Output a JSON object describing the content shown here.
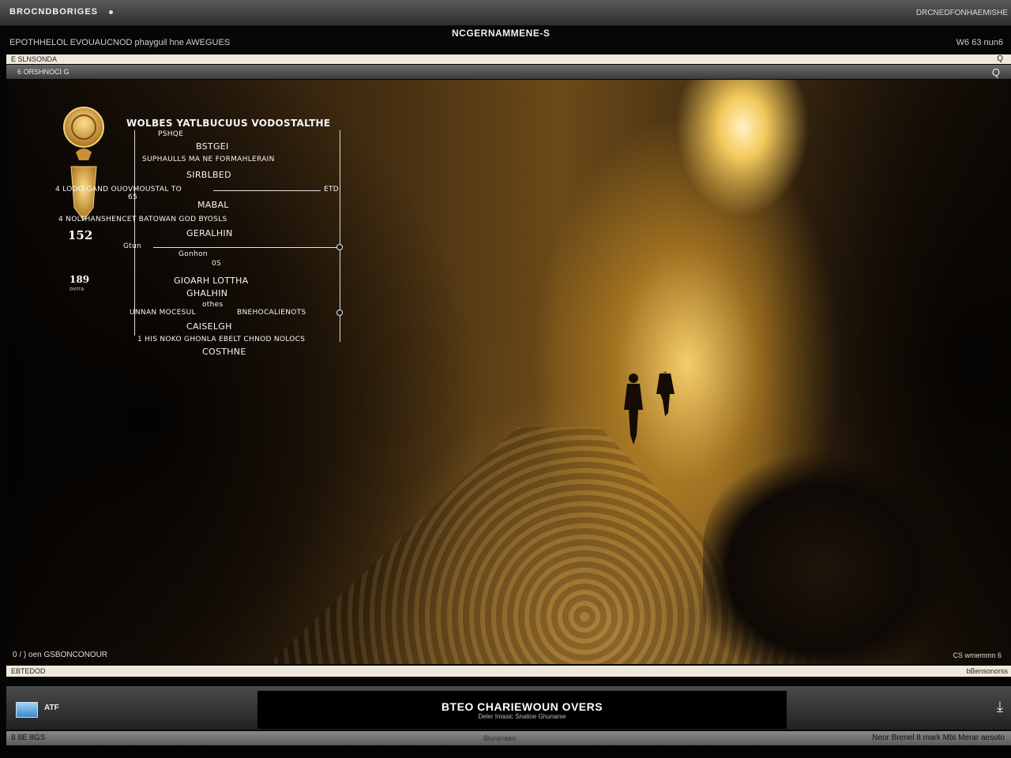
{
  "window": {
    "title": "BROCNDBORIGES",
    "right_status": "DRCNEDFONHAEMISHE"
  },
  "menubar": {
    "left_text": "EPOTHHELOL EVOUAUCNOD phayguil hne AWEGUES",
    "center_title": "NCGERNAMMENE-S",
    "right_text": "W6 63 nun6"
  },
  "address": {
    "left": "E SLNSONDA",
    "right": "Q"
  },
  "subbar": {
    "left": "6 ORSHNOCI G",
    "right": "Q"
  },
  "panel": {
    "stat_a": "152",
    "stat_b": "189",
    "stat_b_label": "ovrra",
    "heading": "WOLBES YATLBUCUUS VODOSTALTHE",
    "nodes": [
      {
        "text": "PSHQE"
      },
      {
        "text": "BSTGEI"
      },
      {
        "text": "SUPHAULLS MA NE FORMAHLERAIN"
      },
      {
        "text": "SIRBLBED"
      },
      {
        "text": "4 LODO GAND OUOVMOUSTAL TO"
      },
      {
        "text": "ETD"
      },
      {
        "text": "65"
      },
      {
        "text": "MABAL"
      },
      {
        "text": "4 NOLTHANSHENCET BATOWAN GOD BYOSLS"
      },
      {
        "text": "GERALHIN"
      },
      {
        "text": "Gtun"
      },
      {
        "text": "Gonhon"
      },
      {
        "text": "0S"
      },
      {
        "text": "GIOARH LOTTHA"
      },
      {
        "text": "GHALHIN"
      },
      {
        "text": "othes"
      },
      {
        "text": "UNNAN MOCESUL"
      },
      {
        "text": "BNEHOCALIENOTS"
      },
      {
        "text": "CAISELGH"
      },
      {
        "text": "1 HIS NOKO GHONLA EBELT CHNOD NOLOCS"
      },
      {
        "text": "COSTHNE"
      }
    ]
  },
  "viewport": {
    "bottom_left": "0 / ) oen GSBONCONOUR",
    "bottom_right": "CS wmemmn 6"
  },
  "status": {
    "left": "EBTEDOD",
    "right": "bBensonorss"
  },
  "taskbar": {
    "app_label": "ATF",
    "now_playing_title": "BTEO CHARIEWOUN OVERS",
    "now_playing_sub": "Deler Imasic Snatioe Ghunarse",
    "right_icon": "download-icon"
  },
  "footer": {
    "left": "8 8E 8GS",
    "center": "Bluranaen",
    "right": "Neor Brenel 8 mark MbI Merar aesoto"
  },
  "colors": {
    "accent_gold": "#e0a83a",
    "chrome_dark": "#2e2e2e",
    "paper": "#efe9dc"
  }
}
